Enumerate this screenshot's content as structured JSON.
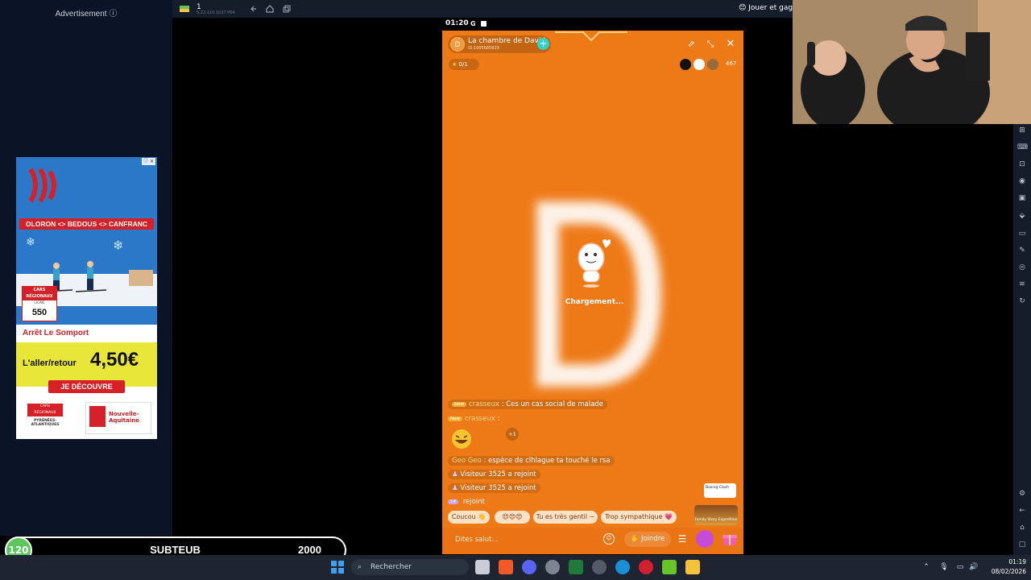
{
  "ad": {
    "label": "Advertisement ⓘ",
    "route": "OLORON <> BEDOUS <> CANFRANC",
    "line_top": "CARS RÉGIONAUX",
    "line_label": "LIGNE",
    "line_number": "550",
    "stop": "Arrêt Le Somport",
    "price_label": "L'aller/retour",
    "price": "4,50€",
    "cta": "JE DÉCOUVRE",
    "logo_left": "CARS RÉGIONAUX PYRÉNÉES-ATLANTIQUES",
    "logo_right": "Nouvelle-Aquitaine",
    "corner": "ⓘ ✕"
  },
  "emulator": {
    "title": "1",
    "subtitle": "5.22.110.1037 P64",
    "promo": "Jouer et gagn"
  },
  "status_bar": {
    "time": "01:20"
  },
  "room": {
    "avatar_letter": "D",
    "name": "La chambre de David",
    "id": "ID:1005685829",
    "follow": "+",
    "stars": "0/1",
    "viewer_count": "467",
    "loading": "Chargement..."
  },
  "chat": [
    {
      "badge": "New",
      "name": "crasseux",
      "sep": " : ",
      "text": "Ces un cas social de malade"
    },
    {
      "badge": "New",
      "name": "crasseux",
      "sep": " :",
      "text": ""
    },
    {
      "badge": "",
      "name": "Geo Geo",
      "sep": " : ",
      "text": "espèce de clhlague ta touché le rsa"
    },
    {
      "badge": "",
      "name": "",
      "sep": "",
      "text": "Visiteur 3525 a rejoint"
    },
    {
      "badge": "",
      "name": "",
      "sep": "",
      "text": "Visiteur 3525 a rejoint"
    },
    {
      "badge": "14",
      "name": "",
      "sep": "",
      "text": "rejoint"
    }
  ],
  "plus_one": "+1",
  "quick_replies": [
    "Coucou 👋",
    "😍😍😍",
    "Tu es très gentil ~",
    "Trop sympathique 💗"
  ],
  "game_banner": "Family Story Expedition",
  "boxing_badge": "Boxing Clash",
  "bottom": {
    "placeholder": "Dites salut...",
    "join": "Joindre"
  },
  "sub_goal": {
    "count": "120",
    "label": "SUBTEUB",
    "target": "2000"
  },
  "taskbar": {
    "search": "Rechercher",
    "time": "01:19",
    "date": "08/02/2026"
  },
  "colors": {
    "phone_bg": "#ee7a17",
    "sub_green": "#5cc65a",
    "ad_red": "#d62027",
    "ad_yellow": "#e9e63a"
  }
}
